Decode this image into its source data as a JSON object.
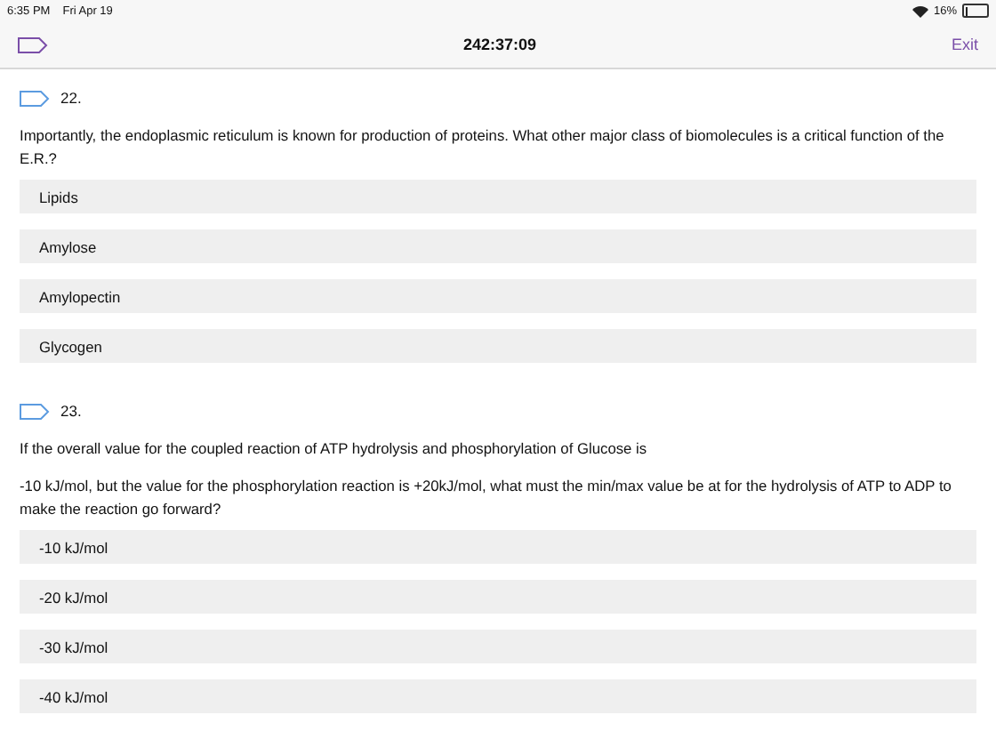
{
  "status_bar": {
    "time": "6:35 PM",
    "date": "Fri Apr 19",
    "battery": "16%"
  },
  "nav_bar": {
    "timer": "242:37:09",
    "exit": "Exit"
  },
  "questions": [
    {
      "number": "22.",
      "flagged": false,
      "paragraphs": [
        "Importantly, the endoplasmic reticulum is known for production of proteins.  What other major class of biomolecules is a critical function of the E.R.?"
      ],
      "options": [
        "Lipids",
        "Amylose",
        "Amylopectin",
        "Glycogen"
      ]
    },
    {
      "number": "23.",
      "flagged": false,
      "paragraphs": [
        "If the overall value for the coupled reaction of ATP hydrolysis and phosphorylation of Glucose is",
        "-10 kJ/mol, but the value for the phosphorylation reaction is +20kJ/mol, what must the min/max value be at for the hydrolysis of ATP to ADP to make the reaction go forward?"
      ],
      "options": [
        "-10 kJ/mol",
        "-20 kJ/mol",
        "-30 kJ/mol",
        "-40 kJ/mol"
      ]
    }
  ]
}
